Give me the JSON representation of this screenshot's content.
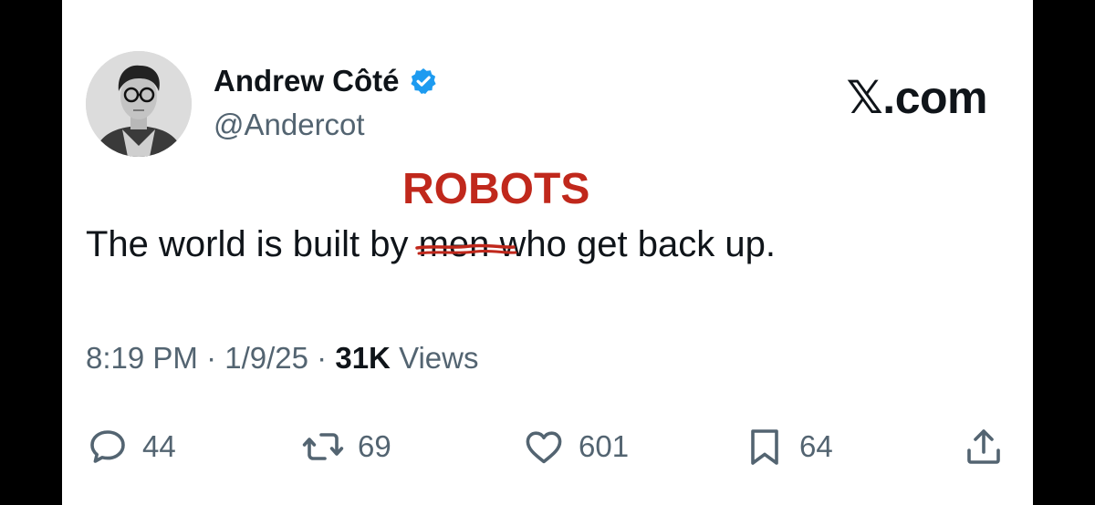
{
  "tweet": {
    "author_name": "Andrew Côté",
    "handle": "@Andercot",
    "source_label": "𝕏.com",
    "annotation": "ROBOTS",
    "text_before": "The world is built by ",
    "text_struck": "men",
    "text_after": " who get back up.",
    "time": "8:19 PM",
    "date": "1/9/25",
    "separator": "·",
    "views_count": "31K",
    "views_label": "Views"
  },
  "actions": {
    "replies": "44",
    "reposts": "69",
    "likes": "601",
    "bookmarks": "64"
  },
  "icons": {
    "verified": "verified-badge-icon",
    "reply": "speech-bubble-icon",
    "repost": "repost-arrows-icon",
    "like": "heart-icon",
    "bookmark": "bookmark-icon",
    "share": "share-upload-icon"
  },
  "colors": {
    "verified_blue": "#1d9bf0",
    "annotation_red": "#c0281c",
    "text_primary": "#0f1419",
    "text_secondary": "#536471"
  }
}
